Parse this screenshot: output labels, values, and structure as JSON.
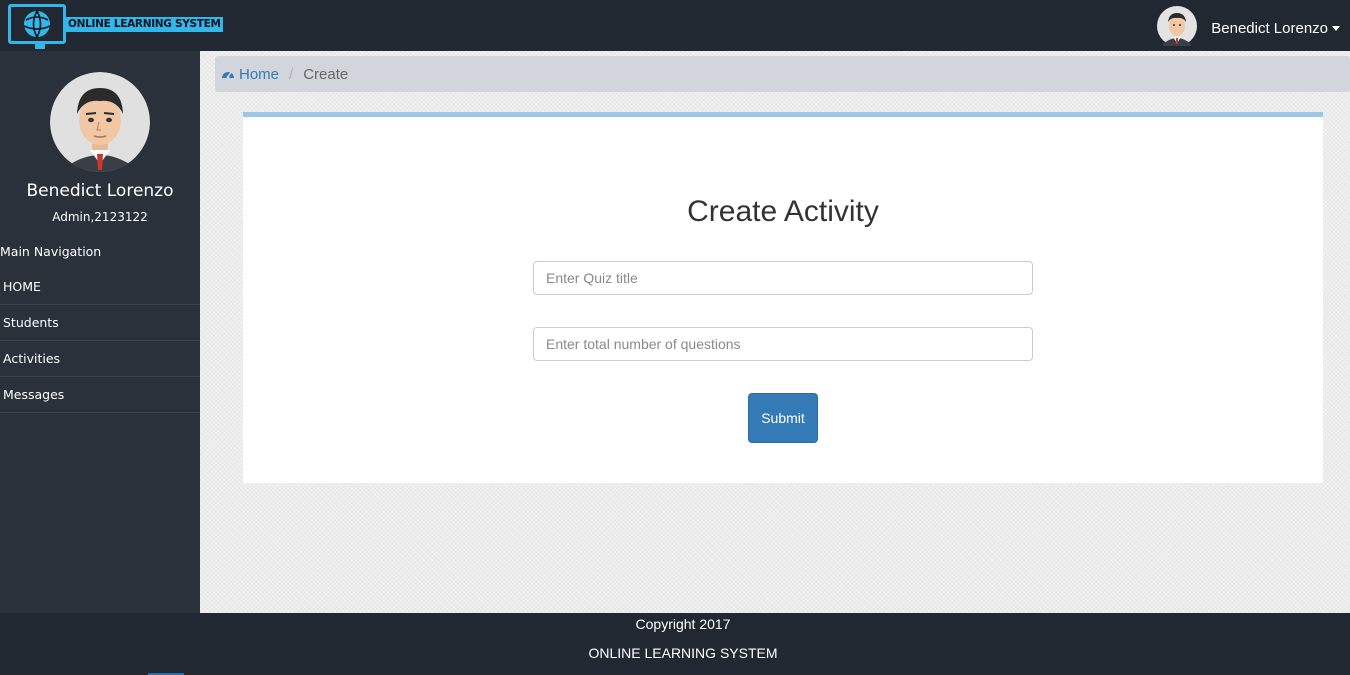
{
  "app": {
    "logo_text": "ONLINE LEARNING SYSTEM",
    "accent_color": "#35b6e8",
    "navbar_color": "#222831"
  },
  "header": {
    "user_name": "Benedict Lorenzo",
    "user_avatar_icon": "male-avatar-icon"
  },
  "sidebar": {
    "user_name": "Benedict Lorenzo",
    "user_role": "Admin,2123122",
    "section_title": "Main Navigation",
    "items": [
      {
        "label": "HOME"
      },
      {
        "label": "Students"
      },
      {
        "label": "Activities"
      },
      {
        "label": "Messages"
      }
    ]
  },
  "breadcrumb": {
    "home_icon": "dashboard-icon",
    "home_label": "Home",
    "separator": "/",
    "current_label": "Create"
  },
  "form": {
    "title": "Create Activity",
    "quiz_title": {
      "value": "",
      "placeholder": "Enter Quiz title"
    },
    "question_count": {
      "value": "",
      "placeholder": "Enter total number of questions"
    },
    "submit_label": "Submit",
    "submit_color": "#337ab7"
  },
  "footer": {
    "copyright": "Copyright 2017",
    "app_name": "ONLINE LEARNING SYSTEM"
  }
}
